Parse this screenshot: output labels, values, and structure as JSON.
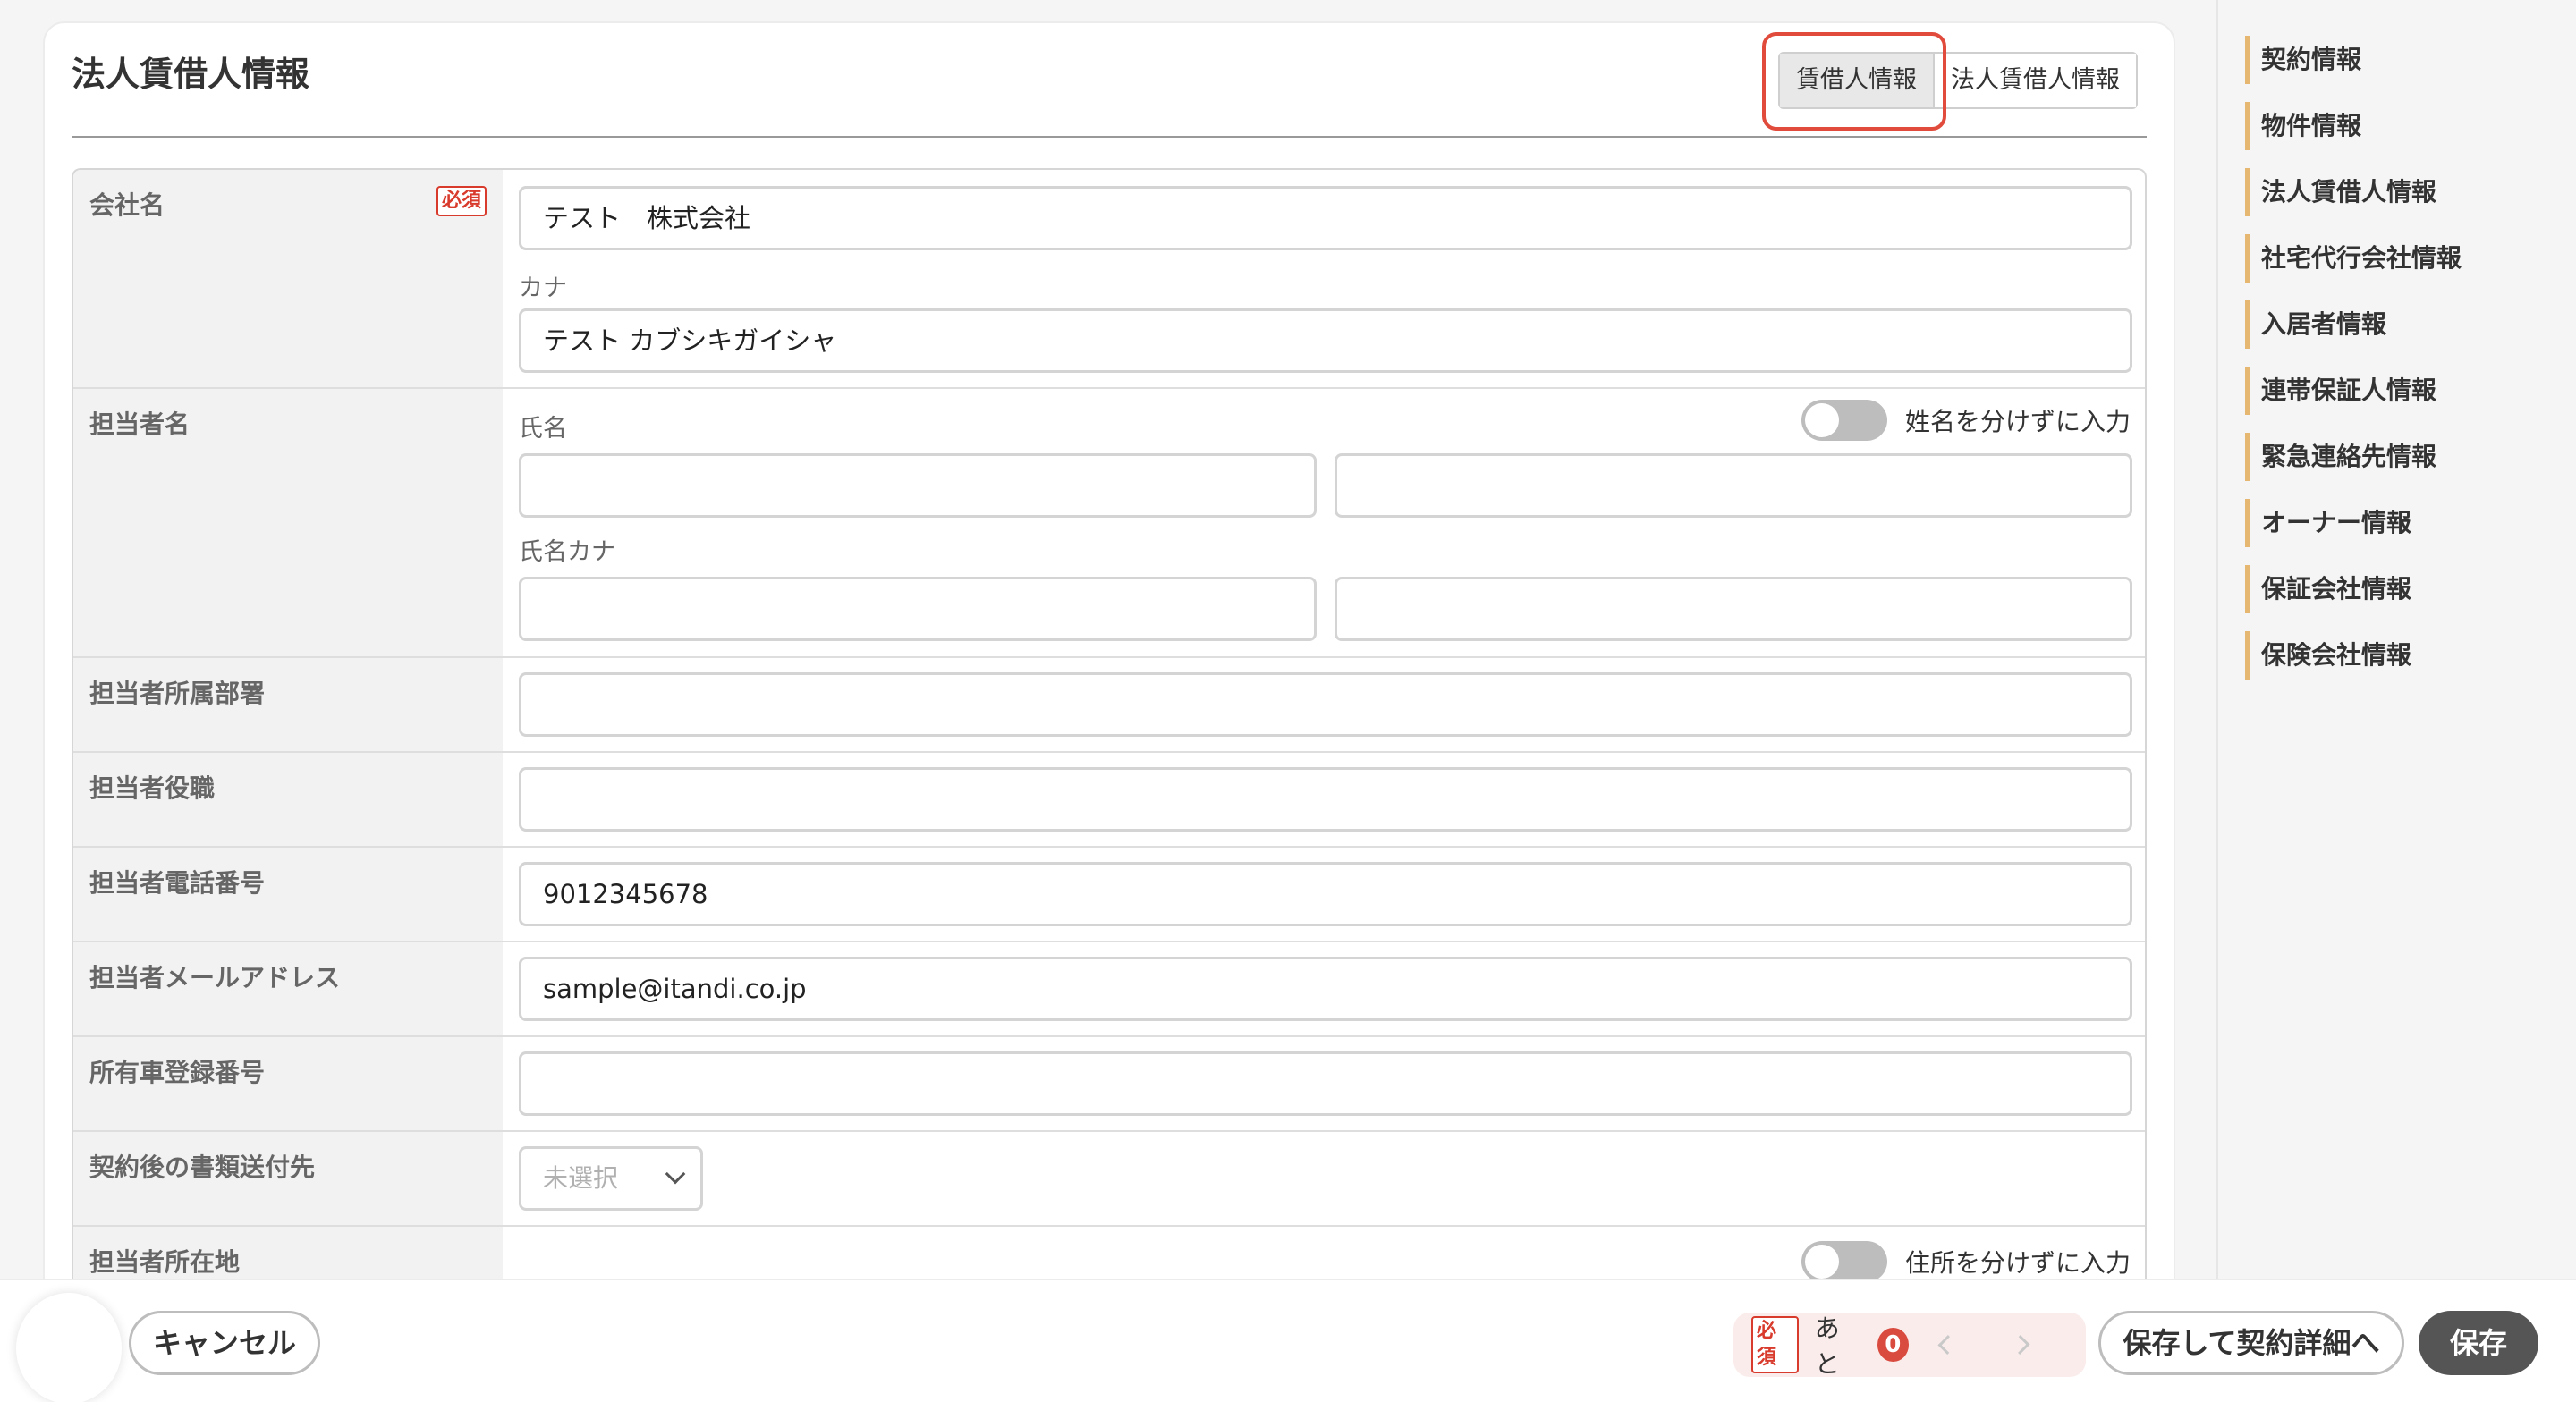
{
  "page": {
    "title": "法人賃借人情報",
    "tabs": [
      "賃借人情報",
      "法人賃借人情報"
    ]
  },
  "form": {
    "required_badge": "必須",
    "company": {
      "label": "会社名",
      "value": "テスト　株式会社",
      "kana_label": "カナ",
      "kana_value": "テスト カブシキガイシャ"
    },
    "contact_name": {
      "label": "担当者名",
      "name_label": "氏名",
      "toggle_label": "姓名を分けずに入力",
      "kana_label": "氏名カナ"
    },
    "department": {
      "label": "担当者所属部署",
      "value": ""
    },
    "position": {
      "label": "担当者役職",
      "value": ""
    },
    "phone": {
      "label": "担当者電話番号",
      "value": "9012345678"
    },
    "email": {
      "label": "担当者メールアドレス",
      "value": "sample@itandi.co.jp"
    },
    "car_number": {
      "label": "所有車登録番号",
      "value": ""
    },
    "doc_destination": {
      "label": "契約後の書類送付先",
      "selected": "未選択"
    },
    "address": {
      "label": "担当者所在地",
      "toggle_label": "住所を分けずに入力"
    }
  },
  "side_nav": {
    "items": [
      "契約情報",
      "物件情報",
      "法人賃借人情報",
      "社宅代行会社情報",
      "入居者情報",
      "連帯保証人情報",
      "緊急連絡先情報",
      "オーナー情報",
      "保証会社情報",
      "保険会社情報"
    ]
  },
  "bottom_bar": {
    "cancel_label": "キャンセル",
    "required_tag": "必須",
    "remaining_label": "あと",
    "remaining_count": "0",
    "save_and_detail_label": "保存して契約詳細へ",
    "save_label": "保存"
  },
  "colors": {
    "accent_bar": "#e5b770",
    "required": "#d83a2c",
    "highlight": "#e04b3c",
    "save_button": "#555555"
  }
}
